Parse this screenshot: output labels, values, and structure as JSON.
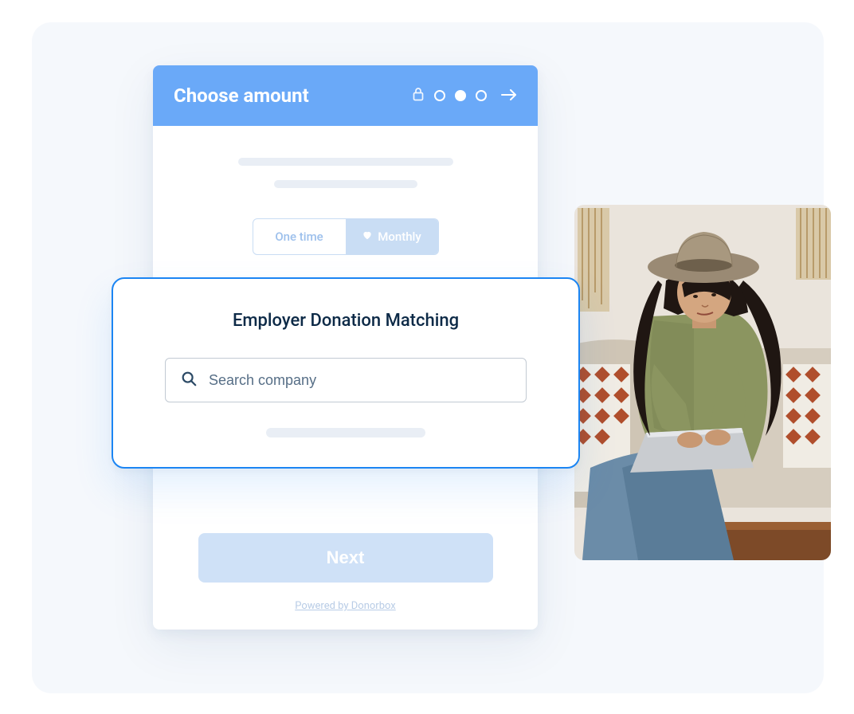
{
  "header": {
    "title": "Choose amount"
  },
  "frequency": {
    "option_onetime": "One time",
    "option_monthly": "Monthly"
  },
  "modal": {
    "title": "Employer Donation Matching",
    "search_placeholder": "Search company"
  },
  "actions": {
    "next": "Next"
  },
  "footer": {
    "powered_by": "Powered by Donorbox"
  },
  "colors": {
    "accent": "#1b85f3",
    "header_bg": "#6aa9f8",
    "button_bg": "#cfe1f7"
  }
}
